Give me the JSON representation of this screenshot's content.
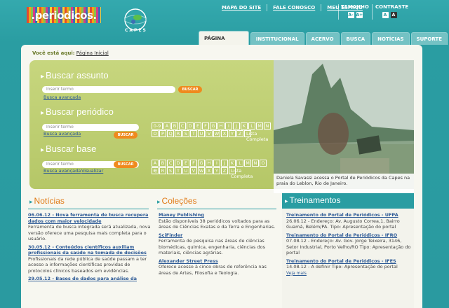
{
  "header": {
    "logo_text": ".periodicos.",
    "capes_text": "CAPES",
    "links": [
      "MAPA DO SITE",
      "FALE CONOSCO",
      "MEU ESPAÇO"
    ],
    "tamanho_label": "TAMANHO",
    "contraste_label": "CONTRASTE",
    "size_buttons": [
      "A-",
      "A+"
    ],
    "contrast_buttons": [
      "A",
      "A"
    ]
  },
  "tabs": [
    "PÁGINA INICIAL",
    "INSTITUCIONAL",
    "ACERVO",
    "BUSCA",
    "NOTÍCIAS",
    "SUPORTE"
  ],
  "breadcrumb": {
    "prefix": "Você está aqui:",
    "link": "Página Inicial"
  },
  "search": {
    "assunto": {
      "title": "Buscar assunto",
      "placeholder": "Inserir termo",
      "button": "BUSCAR",
      "link": "Busca avançada"
    },
    "periodico": {
      "title": "Buscar periódico",
      "placeholder": "Inserir termo",
      "button": "BUSCAR",
      "link": "Busca avançada"
    },
    "base": {
      "title": "Buscar base",
      "placeholder": "Inserir termo",
      "button": "BUSCAR",
      "link": "Busca avançada",
      "link2": "Visualizar"
    },
    "letters_row1": [
      "0-9",
      "A",
      "B",
      "C",
      "D",
      "E",
      "F",
      "G",
      "H",
      "I",
      "J",
      "K",
      "L",
      "M",
      "N"
    ],
    "letters_row2": [
      "O",
      "P",
      "Q",
      "R",
      "S",
      "T",
      "U",
      "V",
      "W",
      "X",
      "Y",
      "Z"
    ],
    "letters_base1": [
      "A",
      "B",
      "C",
      "D",
      "E",
      "F",
      "G",
      "H",
      "I",
      "J",
      "K",
      "L",
      "M",
      "N",
      "O",
      "P"
    ],
    "letters_base2": [
      "Q",
      "R",
      "S",
      "T",
      "U",
      "V",
      "W",
      "X",
      "Y",
      "Z"
    ],
    "lista": "Lista Completa"
  },
  "photo_caption": "Daniela Savassi acessa o Portal de Periódicos da Capes na praia do Leblon, Rio de Janeiro.",
  "noticias": {
    "title": "Notícias",
    "items": [
      {
        "t": "06.06.12 - Nova ferramenta de busca recupera dados com maior velocidade",
        "d": "Ferramenta de busca integrada será atualizada, nova versão oferece uma pesquisa mais completa para o usuário."
      },
      {
        "t": "30.05.12 - Conteúdos científicos auxiliam profissionais da saúde na tomada de decisões",
        "d": "Profissionais da rede pública de saúde passam a ter acesso a informações científicas providas de protocolos clínicos baseados em evidências."
      },
      {
        "t": "29.05.12 - Bases de dados para análise da",
        "d": ""
      }
    ]
  },
  "colecoes": {
    "title": "Coleções",
    "items": [
      {
        "t": "Maney Publishing",
        "d": "Estão disponíveis 38 periódicos voltados para as áreas de Ciências Exatas e da Terra e Engenharias."
      },
      {
        "t": "SciFinder",
        "d": "Ferramenta de pesquisa nas áreas de ciências biomédicas, química, engenharia, ciências dos materiais, ciências agrárias."
      },
      {
        "t": "Alexander Street Press",
        "d": "Oferece acesso à cinco obras de referência nas áreas de Artes, Filosofia e Teologia."
      }
    ]
  },
  "treinamentos": {
    "title": "Treinamentos",
    "items": [
      {
        "t": "Treinamento do Portal de Periódicos - UFPA",
        "d": "26.06.12 - Endereço: Av. Augusto Correa,1, Bairro Guamá, Belém/PA. Tipo: Apresentação do portal"
      },
      {
        "t": "Treinamento do Portal de Periódicos - IFRO",
        "d": "07.08.12 - Endereço: Av. Gov. Jorge Teixeira, 3146, Setor Industrial, Porto Velho/RO Tipo: Apresentação do portal"
      },
      {
        "t": "Treinamento do Portal de Periódicos - IFES",
        "d": "14.08.12 - A definir Tipo: Apresentação do portal"
      }
    ],
    "veja_mais": "Veja mais"
  }
}
